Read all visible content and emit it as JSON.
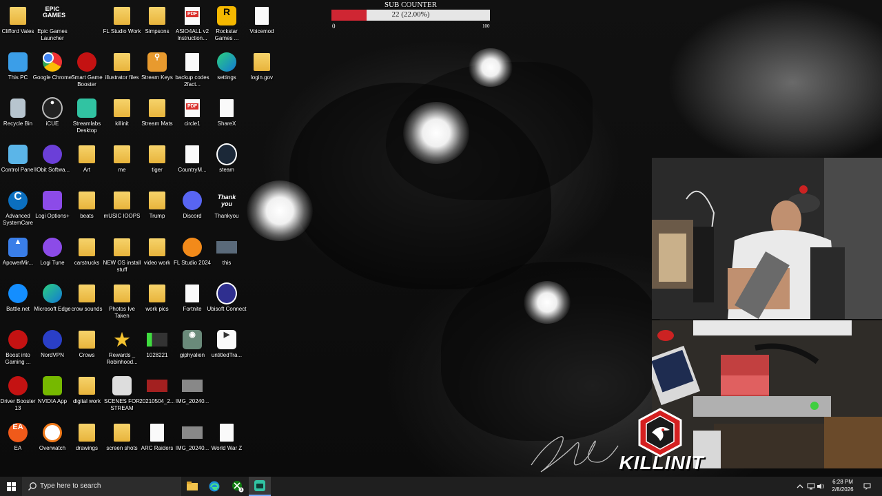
{
  "sub_counter": {
    "title": "SUB COUNTER",
    "value_text": "22 (22.00%)",
    "progress_fraction": 0.22,
    "min_label": "0",
    "max_label": "100",
    "fill_color": "#cf2633",
    "track_color": "#e6e6e6"
  },
  "desktop_icons": [
    {
      "label": "Clifford Vales",
      "kind": "folder"
    },
    {
      "label": "Epic Games Launcher",
      "kind": "epic"
    },
    {
      "label": "FL Studio Work",
      "kind": "folder"
    },
    {
      "label": "Simpsons",
      "kind": "folder"
    },
    {
      "label": "ASIO4ALL v2 Instruction...",
      "kind": "pdf"
    },
    {
      "label": "Rockstar Games ...",
      "kind": "rockstar"
    },
    {
      "label": "Voicemod",
      "kind": "doc"
    },
    {
      "label": "This PC",
      "kind": "pc"
    },
    {
      "label": "Google Chrome",
      "kind": "chrome"
    },
    {
      "label": "Smart Game Booster",
      "kind": "booster"
    },
    {
      "label": "illustrator files",
      "kind": "folder"
    },
    {
      "label": "Stream Keys",
      "kind": "keys"
    },
    {
      "label": "backup codes 2fact...",
      "kind": "doc"
    },
    {
      "label": "settings",
      "kind": "edge"
    },
    {
      "label": "login.gov",
      "kind": "folder"
    },
    {
      "label": "Recycle Bin",
      "kind": "bin"
    },
    {
      "label": "iCUE",
      "kind": "icue"
    },
    {
      "label": "Streamlabs Desktop",
      "kind": "streamlabs"
    },
    {
      "label": "killinit",
      "kind": "folder"
    },
    {
      "label": "Stream Mats",
      "kind": "folder"
    },
    {
      "label": "circle1",
      "kind": "pdf"
    },
    {
      "label": "ShareX",
      "kind": "doc"
    },
    {
      "label": "Control Panel",
      "kind": "cpanel"
    },
    {
      "label": "IObit Softwa...",
      "kind": "iobit"
    },
    {
      "label": "Art",
      "kind": "folder"
    },
    {
      "label": "me",
      "kind": "folder"
    },
    {
      "label": "tiger",
      "kind": "folder"
    },
    {
      "label": "CountryM...",
      "kind": "doc"
    },
    {
      "label": "steam",
      "kind": "steam"
    },
    {
      "label": "Advanced SystemCare",
      "kind": "asc"
    },
    {
      "label": "Logi Options+",
      "kind": "logi"
    },
    {
      "label": "beats",
      "kind": "folder"
    },
    {
      "label": "mUSIC lOOPS",
      "kind": "folder"
    },
    {
      "label": "Trump",
      "kind": "folder"
    },
    {
      "label": "Discord",
      "kind": "discord"
    },
    {
      "label": "Thankyou",
      "kind": "thankyou"
    },
    {
      "label": "ApowerMir...",
      "kind": "apower"
    },
    {
      "label": "Logi Tune",
      "kind": "logitune"
    },
    {
      "label": "carstrucks",
      "kind": "folder"
    },
    {
      "label": "NEW OS install stuff",
      "kind": "folder"
    },
    {
      "label": "video work",
      "kind": "folder"
    },
    {
      "label": "FL Studio 2024",
      "kind": "flstudio"
    },
    {
      "label": "this",
      "kind": "thumb"
    },
    {
      "label": "Battle.net",
      "kind": "battlenet"
    },
    {
      "label": "Microsoft Edge",
      "kind": "edge"
    },
    {
      "label": "crow sounds",
      "kind": "folder"
    },
    {
      "label": "Photos Ive Taken",
      "kind": "folder"
    },
    {
      "label": "work pics",
      "kind": "folder"
    },
    {
      "label": "Fortnite",
      "kind": "doc"
    },
    {
      "label": "Ubisoft Connect",
      "kind": "ubisoft"
    },
    {
      "label": "Boost into Gaming ...",
      "kind": "booster"
    },
    {
      "label": "NordVPN",
      "kind": "nordvpn"
    },
    {
      "label": "Crows",
      "kind": "folder"
    },
    {
      "label": "Rewards _ Robinhood...",
      "kind": "star"
    },
    {
      "label": "1028221",
      "kind": "img"
    },
    {
      "label": "giphyalien",
      "kind": "alien"
    },
    {
      "label": "untitledTra...",
      "kind": "video"
    },
    {
      "label": "Driver Booster 13",
      "kind": "driverbooster"
    },
    {
      "label": "NVIDIA App",
      "kind": "nvidia"
    },
    {
      "label": "digital work",
      "kind": "folder"
    },
    {
      "label": "SCENES FOR STREAM",
      "kind": "scenes"
    },
    {
      "label": "20210504_2...",
      "kind": "redimg"
    },
    {
      "label": "IMG_20240...",
      "kind": "img2"
    },
    {
      "label": "EA",
      "kind": "ea"
    },
    {
      "label": "Overwatch",
      "kind": "overwatch"
    },
    {
      "label": "drawings",
      "kind": "folder"
    },
    {
      "label": "screen shots",
      "kind": "folder"
    },
    {
      "label": "ARC Raiders",
      "kind": "doc"
    },
    {
      "label": "IMG_20240...",
      "kind": "img2"
    },
    {
      "label": "World War Z",
      "kind": "doc"
    }
  ],
  "overlay": {
    "logo_text": "KILLINIT"
  },
  "taskbar": {
    "search_placeholder": "Type here to search",
    "apps": [
      {
        "name": "File Explorer",
        "icon": "folder-icon"
      },
      {
        "name": "Microsoft Edge",
        "icon": "edge-icon"
      },
      {
        "name": "Xbox",
        "icon": "xbox-icon",
        "badge": "3"
      },
      {
        "name": "Streamlabs",
        "icon": "streamlabs-icon"
      }
    ],
    "time": "6:28 PM",
    "date": "2/8/2026"
  }
}
